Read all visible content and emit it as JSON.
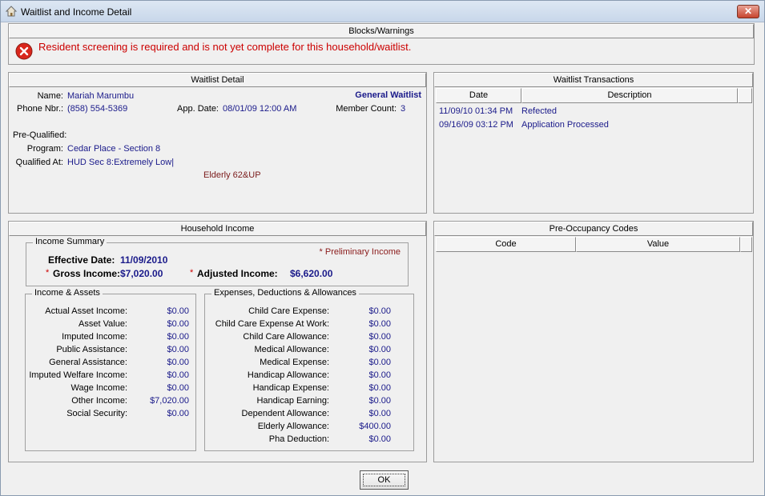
{
  "window": {
    "title": "Waitlist and Income Detail",
    "close_glyph": "✕"
  },
  "blocks": {
    "header": "Blocks/Warnings",
    "message": "Resident screening is required and is not yet complete for this household/waitlist."
  },
  "waitlist_detail": {
    "header": "Waitlist Detail",
    "name_label": "Name:",
    "name": "Mariah Marumbu",
    "type": "General Waitlist",
    "phone_label": "Phone Nbr.:",
    "phone": "(858) 554-5369",
    "app_date_label": "App. Date:",
    "app_date": "08/01/09 12:00 AM",
    "member_count_label": "Member Count:",
    "member_count": "3",
    "prequalified_label": "Pre-Qualified:",
    "program_label": "Program:",
    "program": "Cedar Place - Section 8",
    "qualified_label": "Qualified At:",
    "qualified": "HUD Sec 8:Extremely Low|",
    "elderly": "Elderly 62&UP"
  },
  "transactions": {
    "header": "Waitlist Transactions",
    "columns": [
      "Date",
      "Description"
    ],
    "rows": [
      {
        "date": "11/09/10 01:34 PM",
        "description": "Refected"
      },
      {
        "date": "09/16/09 03:12 PM",
        "description": "Application Processed"
      }
    ]
  },
  "income": {
    "header": "Household Income",
    "summary_title": "Income Summary",
    "preliminary": "* Preliminary Income",
    "effective_label": "Effective Date:",
    "effective_date": "11/09/2010",
    "gross_star": "*",
    "gross_label": "Gross Income:",
    "gross_value": "$7,020.00",
    "adjusted_star": "*",
    "adjusted_label": "Adjusted Income:",
    "adjusted_value": "$6,620.00",
    "assets_title": "Income & Assets",
    "assets": [
      {
        "label": "Actual Asset Income:",
        "value": "$0.00"
      },
      {
        "label": "Asset Value:",
        "value": "$0.00"
      },
      {
        "label": "Imputed Income:",
        "value": "$0.00"
      },
      {
        "label": "Public Assistance:",
        "value": "$0.00"
      },
      {
        "label": "General Assistance:",
        "value": "$0.00"
      },
      {
        "label": "Imputed Welfare Income:",
        "value": "$0.00"
      },
      {
        "label": "Wage Income:",
        "value": "$0.00"
      },
      {
        "label": "Other Income:",
        "value": "$7,020.00"
      },
      {
        "label": "Social Security:",
        "value": "$0.00"
      }
    ],
    "expenses_title": "Expenses, Deductions & Allowances",
    "expenses": [
      {
        "label": "Child Care Expense:",
        "value": "$0.00"
      },
      {
        "label": "Child Care Expense At Work:",
        "value": "$0.00"
      },
      {
        "label": "Child Care Allowance:",
        "value": "$0.00"
      },
      {
        "label": "Medical Allowance:",
        "value": "$0.00"
      },
      {
        "label": "Medical Expense:",
        "value": "$0.00"
      },
      {
        "label": "Handicap Allowance:",
        "value": "$0.00"
      },
      {
        "label": "Handicap Expense:",
        "value": "$0.00"
      },
      {
        "label": "Handicap Earning:",
        "value": "$0.00"
      },
      {
        "label": "Dependent Allowance:",
        "value": "$0.00"
      },
      {
        "label": "Elderly Allowance:",
        "value": "$400.00"
      },
      {
        "label": "Pha Deduction:",
        "value": "$0.00"
      }
    ]
  },
  "preoccupancy": {
    "header": "Pre-Occupancy Codes",
    "columns": [
      "Code",
      "Value"
    ]
  },
  "ok_button": "OK",
  "colors": {
    "value_text": "#1a1a8a",
    "warning_red": "#cc0000",
    "elderly": "#7a1a1a"
  }
}
